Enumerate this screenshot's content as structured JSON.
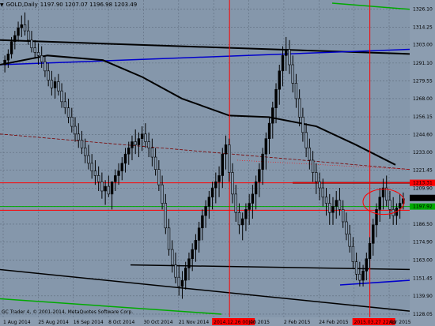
{
  "header": {
    "symbol": "GOLD,Daily",
    "ohlc": "1197.90 1207.07 1196.98 1203.49",
    "dropdown_icon": "triangle-down-icon"
  },
  "footer": {
    "copyright": "GC Trader 4, © 2001-2014, MetaQuotes Software Corp."
  },
  "colors": {
    "background": "#8597ab",
    "candle": "#000000",
    "grid": "#5f6d7e",
    "axis_bg": "#8c9db0",
    "red_line": "#ff0000",
    "green_line": "#00aa00",
    "blue_line": "#0000cc",
    "trend_line": "#000000",
    "dark_red_line": "#7a0000"
  },
  "chart_data": {
    "type": "candlestick",
    "title": "GOLD,Daily",
    "ylim": [
      1128,
      1330
    ],
    "y_ticks": [
      "1326.10",
      "1314.25",
      "1303.00",
      "1291.10",
      "1279.55",
      "1268.00",
      "1256.15",
      "1244.60",
      "1233.00",
      "1221.45",
      "1209.90",
      "1198.05",
      "1186.50",
      "1174.90",
      "1163.00",
      "1151.45",
      "1139.90",
      "1128.05"
    ],
    "x_ticks": [
      "1 Aug 2014",
      "25 Aug 2014",
      "16 Sep 2014",
      "8 Oct 2014",
      "30 Oct 2014",
      "21 Nov 2014",
      "2014.12.26 00:00",
      "Jan 2015",
      "2 Feb 2015",
      "24 Feb 2015",
      "2015.03.27 22:00",
      "Apr 2015"
    ],
    "highlighted_x_ticks": [
      "2014.12.26 00:00",
      "2015.03.27 22:00"
    ],
    "price_labels": [
      {
        "text": "1213.31",
        "value": 1213.31,
        "color": "#ff0000"
      },
      {
        "text": "1203.49",
        "value": 1203.49,
        "color": "#000000"
      },
      {
        "text": "1197.92",
        "value": 1197.92,
        "color": "#00aa00"
      }
    ],
    "horizontal_lines": [
      {
        "value": 1213.31,
        "color": "#ff0000"
      },
      {
        "value": 1197.92,
        "color": "#00aa00"
      },
      {
        "value": 1195.5,
        "color": "#ff0000"
      }
    ],
    "dashed_levels": [
      {
        "value": 1238.0,
        "color": "#b22222"
      },
      {
        "value": 1222.0,
        "color": "#ff4444"
      }
    ],
    "vertical_markers": [
      "2014.12.26 00:00",
      "2015.03.27 22:00"
    ],
    "series": [
      {
        "name": "GOLD,Daily",
        "ohlc": [
          [
            1290,
            1296,
            1285,
            1293
          ],
          [
            1293,
            1300,
            1288,
            1297
          ],
          [
            1297,
            1308,
            1294,
            1305
          ],
          [
            1305,
            1312,
            1300,
            1309
          ],
          [
            1309,
            1318,
            1305,
            1314
          ],
          [
            1314,
            1322,
            1308,
            1316
          ],
          [
            1316,
            1324,
            1309,
            1312
          ],
          [
            1312,
            1319,
            1303,
            1306
          ],
          [
            1306,
            1312,
            1298,
            1301
          ],
          [
            1301,
            1306,
            1294,
            1298
          ],
          [
            1298,
            1304,
            1290,
            1296
          ],
          [
            1296,
            1302,
            1288,
            1292
          ],
          [
            1292,
            1296,
            1282,
            1286
          ],
          [
            1286,
            1291,
            1276,
            1280
          ],
          [
            1280,
            1286,
            1270,
            1275
          ],
          [
            1275,
            1282,
            1268,
            1279
          ],
          [
            1279,
            1284,
            1270,
            1273
          ],
          [
            1273,
            1278,
            1262,
            1266
          ],
          [
            1266,
            1272,
            1258,
            1262
          ],
          [
            1262,
            1268,
            1252,
            1256
          ],
          [
            1256,
            1262,
            1246,
            1250
          ],
          [
            1250,
            1256,
            1240,
            1245
          ],
          [
            1245,
            1252,
            1236,
            1241
          ],
          [
            1241,
            1247,
            1232,
            1236
          ],
          [
            1236,
            1242,
            1226,
            1231
          ],
          [
            1231,
            1238,
            1222,
            1226
          ],
          [
            1226,
            1232,
            1216,
            1221
          ],
          [
            1221,
            1228,
            1212,
            1218
          ],
          [
            1218,
            1224,
            1208,
            1214
          ],
          [
            1214,
            1220,
            1203,
            1208
          ],
          [
            1208,
            1215,
            1199,
            1211
          ],
          [
            1211,
            1218,
            1204,
            1206
          ],
          [
            1206,
            1212,
            1196,
            1214
          ],
          [
            1214,
            1222,
            1208,
            1218
          ],
          [
            1218,
            1226,
            1212,
            1221
          ],
          [
            1221,
            1230,
            1215,
            1226
          ],
          [
            1226,
            1236,
            1220,
            1232
          ],
          [
            1232,
            1240,
            1225,
            1236
          ],
          [
            1236,
            1244,
            1228,
            1240
          ],
          [
            1240,
            1248,
            1232,
            1238
          ],
          [
            1238,
            1246,
            1230,
            1242
          ],
          [
            1242,
            1250,
            1234,
            1245
          ],
          [
            1245,
            1252,
            1236,
            1240
          ],
          [
            1240,
            1246,
            1230,
            1236
          ],
          [
            1236,
            1242,
            1224,
            1230
          ],
          [
            1230,
            1236,
            1218,
            1222
          ],
          [
            1222,
            1228,
            1208,
            1212
          ],
          [
            1212,
            1218,
            1196,
            1200
          ],
          [
            1200,
            1206,
            1180,
            1184
          ],
          [
            1184,
            1190,
            1166,
            1170
          ],
          [
            1170,
            1176,
            1155,
            1160
          ],
          [
            1160,
            1168,
            1148,
            1152
          ],
          [
            1152,
            1160,
            1140,
            1146
          ],
          [
            1146,
            1156,
            1138,
            1150
          ],
          [
            1150,
            1162,
            1144,
            1158
          ],
          [
            1158,
            1168,
            1150,
            1164
          ],
          [
            1164,
            1174,
            1156,
            1170
          ],
          [
            1170,
            1180,
            1162,
            1176
          ],
          [
            1176,
            1188,
            1168,
            1184
          ],
          [
            1184,
            1196,
            1176,
            1192
          ],
          [
            1192,
            1202,
            1184,
            1198
          ],
          [
            1198,
            1208,
            1190,
            1204
          ],
          [
            1204,
            1214,
            1196,
            1210
          ],
          [
            1210,
            1220,
            1200,
            1214
          ],
          [
            1214,
            1224,
            1204,
            1218
          ],
          [
            1218,
            1236,
            1210,
            1232
          ],
          [
            1232,
            1244,
            1222,
            1238
          ],
          [
            1238,
            1242,
            1214,
            1220
          ],
          [
            1220,
            1226,
            1200,
            1206
          ],
          [
            1206,
            1212,
            1188,
            1194
          ],
          [
            1194,
            1200,
            1180,
            1186
          ],
          [
            1186,
            1194,
            1176,
            1190
          ],
          [
            1190,
            1200,
            1182,
            1196
          ],
          [
            1196,
            1206,
            1186,
            1200
          ],
          [
            1200,
            1212,
            1190,
            1206
          ],
          [
            1206,
            1218,
            1196,
            1214
          ],
          [
            1214,
            1226,
            1204,
            1222
          ],
          [
            1222,
            1236,
            1212,
            1232
          ],
          [
            1232,
            1246,
            1222,
            1242
          ],
          [
            1242,
            1256,
            1232,
            1252
          ],
          [
            1252,
            1266,
            1242,
            1262
          ],
          [
            1262,
            1278,
            1252,
            1274
          ],
          [
            1274,
            1290,
            1264,
            1286
          ],
          [
            1286,
            1302,
            1276,
            1296
          ],
          [
            1296,
            1308,
            1286,
            1300
          ],
          [
            1300,
            1306,
            1284,
            1290
          ],
          [
            1290,
            1296,
            1272,
            1278
          ],
          [
            1278,
            1284,
            1262,
            1268
          ],
          [
            1268,
            1274,
            1250,
            1256
          ],
          [
            1256,
            1262,
            1240,
            1246
          ],
          [
            1246,
            1252,
            1230,
            1236
          ],
          [
            1236,
            1242,
            1222,
            1228
          ],
          [
            1228,
            1234,
            1214,
            1220
          ],
          [
            1220,
            1226,
            1206,
            1214
          ],
          [
            1214,
            1220,
            1202,
            1210
          ],
          [
            1210,
            1216,
            1198,
            1204
          ],
          [
            1204,
            1210,
            1192,
            1200
          ],
          [
            1200,
            1206,
            1186,
            1194
          ],
          [
            1194,
            1204,
            1186,
            1198
          ],
          [
            1198,
            1208,
            1190,
            1202
          ],
          [
            1202,
            1210,
            1192,
            1196
          ],
          [
            1196,
            1202,
            1184,
            1188
          ],
          [
            1188,
            1194,
            1176,
            1180
          ],
          [
            1180,
            1186,
            1168,
            1172
          ],
          [
            1172,
            1178,
            1158,
            1162
          ],
          [
            1162,
            1168,
            1150,
            1154
          ],
          [
            1154,
            1162,
            1146,
            1150
          ],
          [
            1150,
            1160,
            1146,
            1156
          ],
          [
            1156,
            1168,
            1150,
            1164
          ],
          [
            1164,
            1178,
            1158,
            1174
          ],
          [
            1174,
            1190,
            1166,
            1186
          ],
          [
            1186,
            1200,
            1178,
            1196
          ],
          [
            1196,
            1210,
            1188,
            1204
          ],
          [
            1204,
            1216,
            1196,
            1210
          ],
          [
            1210,
            1218,
            1198,
            1202
          ],
          [
            1202,
            1208,
            1190,
            1196
          ],
          [
            1196,
            1204,
            1186,
            1192
          ],
          [
            1192,
            1200,
            1186,
            1197
          ],
          [
            1197,
            1206,
            1190,
            1200
          ],
          [
            1200,
            1207,
            1196,
            1203
          ]
        ]
      }
    ]
  }
}
